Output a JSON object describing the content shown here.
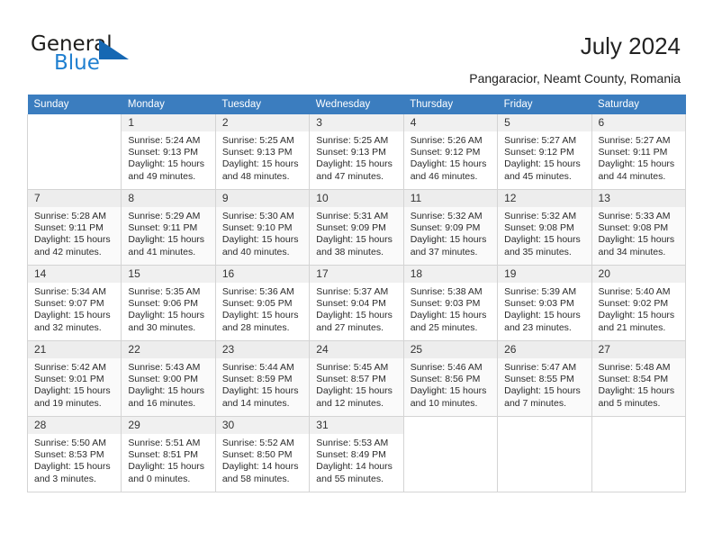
{
  "brand": {
    "name_part1": "General",
    "name_part2": "Blue",
    "logo_icon": "triangle-logo-icon",
    "accent_color": "#1668b3"
  },
  "header": {
    "title": "July 2024",
    "subtitle": "Pangaracior, Neamt County, Romania"
  },
  "calendar": {
    "header_bg": "#3b7dbf",
    "weekday_headers": [
      "Sunday",
      "Monday",
      "Tuesday",
      "Wednesday",
      "Thursday",
      "Friday",
      "Saturday"
    ],
    "weeks": [
      [
        {
          "day": "",
          "lines": []
        },
        {
          "day": "1",
          "lines": [
            "Sunrise: 5:24 AM",
            "Sunset: 9:13 PM",
            "Daylight: 15 hours",
            "and 49 minutes."
          ]
        },
        {
          "day": "2",
          "lines": [
            "Sunrise: 5:25 AM",
            "Sunset: 9:13 PM",
            "Daylight: 15 hours",
            "and 48 minutes."
          ]
        },
        {
          "day": "3",
          "lines": [
            "Sunrise: 5:25 AM",
            "Sunset: 9:13 PM",
            "Daylight: 15 hours",
            "and 47 minutes."
          ]
        },
        {
          "day": "4",
          "lines": [
            "Sunrise: 5:26 AM",
            "Sunset: 9:12 PM",
            "Daylight: 15 hours",
            "and 46 minutes."
          ]
        },
        {
          "day": "5",
          "lines": [
            "Sunrise: 5:27 AM",
            "Sunset: 9:12 PM",
            "Daylight: 15 hours",
            "and 45 minutes."
          ]
        },
        {
          "day": "6",
          "lines": [
            "Sunrise: 5:27 AM",
            "Sunset: 9:11 PM",
            "Daylight: 15 hours",
            "and 44 minutes."
          ]
        }
      ],
      [
        {
          "day": "7",
          "lines": [
            "Sunrise: 5:28 AM",
            "Sunset: 9:11 PM",
            "Daylight: 15 hours",
            "and 42 minutes."
          ]
        },
        {
          "day": "8",
          "lines": [
            "Sunrise: 5:29 AM",
            "Sunset: 9:11 PM",
            "Daylight: 15 hours",
            "and 41 minutes."
          ]
        },
        {
          "day": "9",
          "lines": [
            "Sunrise: 5:30 AM",
            "Sunset: 9:10 PM",
            "Daylight: 15 hours",
            "and 40 minutes."
          ]
        },
        {
          "day": "10",
          "lines": [
            "Sunrise: 5:31 AM",
            "Sunset: 9:09 PM",
            "Daylight: 15 hours",
            "and 38 minutes."
          ]
        },
        {
          "day": "11",
          "lines": [
            "Sunrise: 5:32 AM",
            "Sunset: 9:09 PM",
            "Daylight: 15 hours",
            "and 37 minutes."
          ]
        },
        {
          "day": "12",
          "lines": [
            "Sunrise: 5:32 AM",
            "Sunset: 9:08 PM",
            "Daylight: 15 hours",
            "and 35 minutes."
          ]
        },
        {
          "day": "13",
          "lines": [
            "Sunrise: 5:33 AM",
            "Sunset: 9:08 PM",
            "Daylight: 15 hours",
            "and 34 minutes."
          ]
        }
      ],
      [
        {
          "day": "14",
          "lines": [
            "Sunrise: 5:34 AM",
            "Sunset: 9:07 PM",
            "Daylight: 15 hours",
            "and 32 minutes."
          ]
        },
        {
          "day": "15",
          "lines": [
            "Sunrise: 5:35 AM",
            "Sunset: 9:06 PM",
            "Daylight: 15 hours",
            "and 30 minutes."
          ]
        },
        {
          "day": "16",
          "lines": [
            "Sunrise: 5:36 AM",
            "Sunset: 9:05 PM",
            "Daylight: 15 hours",
            "and 28 minutes."
          ]
        },
        {
          "day": "17",
          "lines": [
            "Sunrise: 5:37 AM",
            "Sunset: 9:04 PM",
            "Daylight: 15 hours",
            "and 27 minutes."
          ]
        },
        {
          "day": "18",
          "lines": [
            "Sunrise: 5:38 AM",
            "Sunset: 9:03 PM",
            "Daylight: 15 hours",
            "and 25 minutes."
          ]
        },
        {
          "day": "19",
          "lines": [
            "Sunrise: 5:39 AM",
            "Sunset: 9:03 PM",
            "Daylight: 15 hours",
            "and 23 minutes."
          ]
        },
        {
          "day": "20",
          "lines": [
            "Sunrise: 5:40 AM",
            "Sunset: 9:02 PM",
            "Daylight: 15 hours",
            "and 21 minutes."
          ]
        }
      ],
      [
        {
          "day": "21",
          "lines": [
            "Sunrise: 5:42 AM",
            "Sunset: 9:01 PM",
            "Daylight: 15 hours",
            "and 19 minutes."
          ]
        },
        {
          "day": "22",
          "lines": [
            "Sunrise: 5:43 AM",
            "Sunset: 9:00 PM",
            "Daylight: 15 hours",
            "and 16 minutes."
          ]
        },
        {
          "day": "23",
          "lines": [
            "Sunrise: 5:44 AM",
            "Sunset: 8:59 PM",
            "Daylight: 15 hours",
            "and 14 minutes."
          ]
        },
        {
          "day": "24",
          "lines": [
            "Sunrise: 5:45 AM",
            "Sunset: 8:57 PM",
            "Daylight: 15 hours",
            "and 12 minutes."
          ]
        },
        {
          "day": "25",
          "lines": [
            "Sunrise: 5:46 AM",
            "Sunset: 8:56 PM",
            "Daylight: 15 hours",
            "and 10 minutes."
          ]
        },
        {
          "day": "26",
          "lines": [
            "Sunrise: 5:47 AM",
            "Sunset: 8:55 PM",
            "Daylight: 15 hours",
            "and 7 minutes."
          ]
        },
        {
          "day": "27",
          "lines": [
            "Sunrise: 5:48 AM",
            "Sunset: 8:54 PM",
            "Daylight: 15 hours",
            "and 5 minutes."
          ]
        }
      ],
      [
        {
          "day": "28",
          "lines": [
            "Sunrise: 5:50 AM",
            "Sunset: 8:53 PM",
            "Daylight: 15 hours",
            "and 3 minutes."
          ]
        },
        {
          "day": "29",
          "lines": [
            "Sunrise: 5:51 AM",
            "Sunset: 8:51 PM",
            "Daylight: 15 hours",
            "and 0 minutes."
          ]
        },
        {
          "day": "30",
          "lines": [
            "Sunrise: 5:52 AM",
            "Sunset: 8:50 PM",
            "Daylight: 14 hours",
            "and 58 minutes."
          ]
        },
        {
          "day": "31",
          "lines": [
            "Sunrise: 5:53 AM",
            "Sunset: 8:49 PM",
            "Daylight: 14 hours",
            "and 55 minutes."
          ]
        },
        {
          "day": "",
          "lines": []
        },
        {
          "day": "",
          "lines": []
        },
        {
          "day": "",
          "lines": []
        }
      ]
    ]
  }
}
